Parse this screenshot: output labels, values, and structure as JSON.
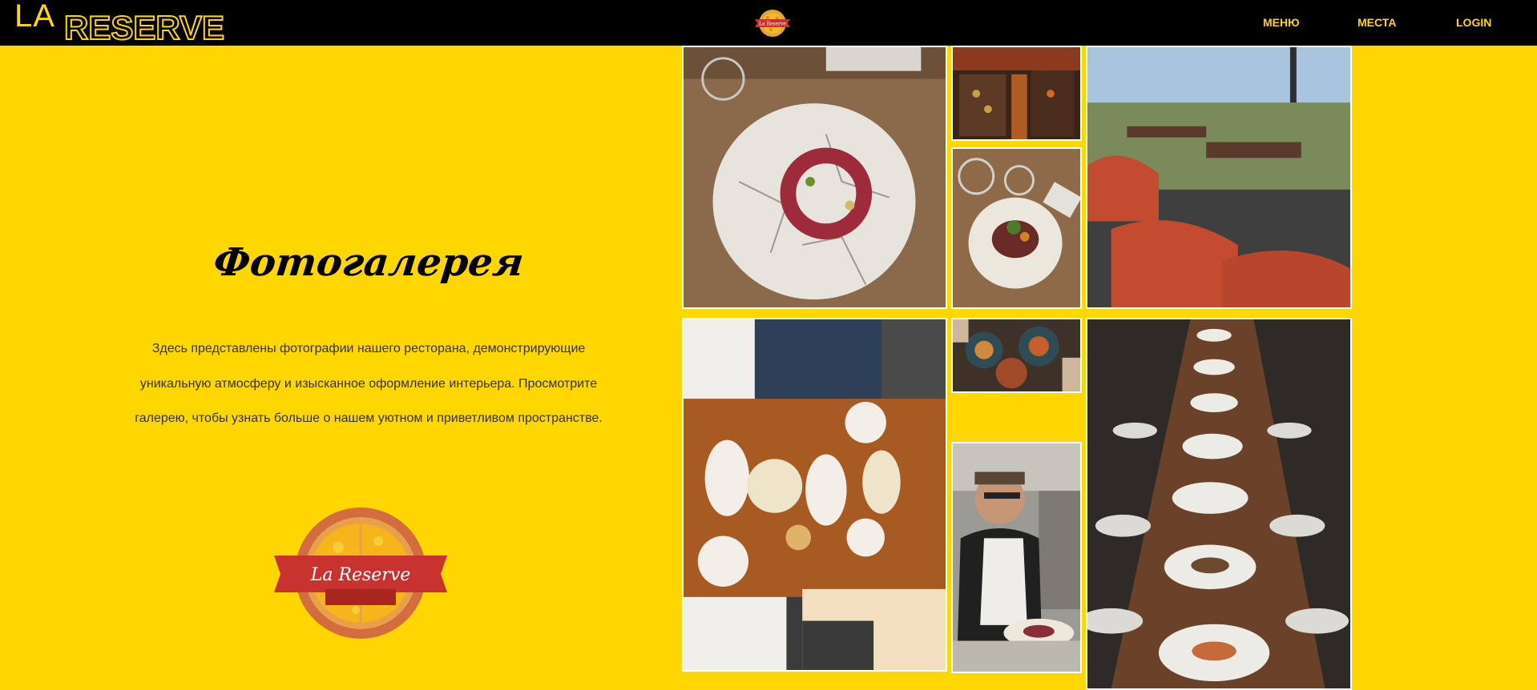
{
  "header": {
    "brand_la": "LA",
    "brand_reserve": "RESERVE",
    "nav": [
      {
        "label": "МЕНЮ"
      },
      {
        "label": "МЕСТА"
      },
      {
        "label": "LOGIN"
      }
    ]
  },
  "gallery": {
    "title": "Фотогалерея",
    "description": "Здесь представлены фотографии нашего ресторана, демонстрирующие уникальную атмосферу и изысканное оформление интерьера. Просмотрите галерею, чтобы узнать больше о нашем уютном и приветливом пространстве."
  },
  "logo": {
    "text": "La Reserve"
  },
  "colors": {
    "background": "#FFD700",
    "header": "#000000",
    "accent": "#FFD700",
    "ribbon": "#C8322F"
  }
}
